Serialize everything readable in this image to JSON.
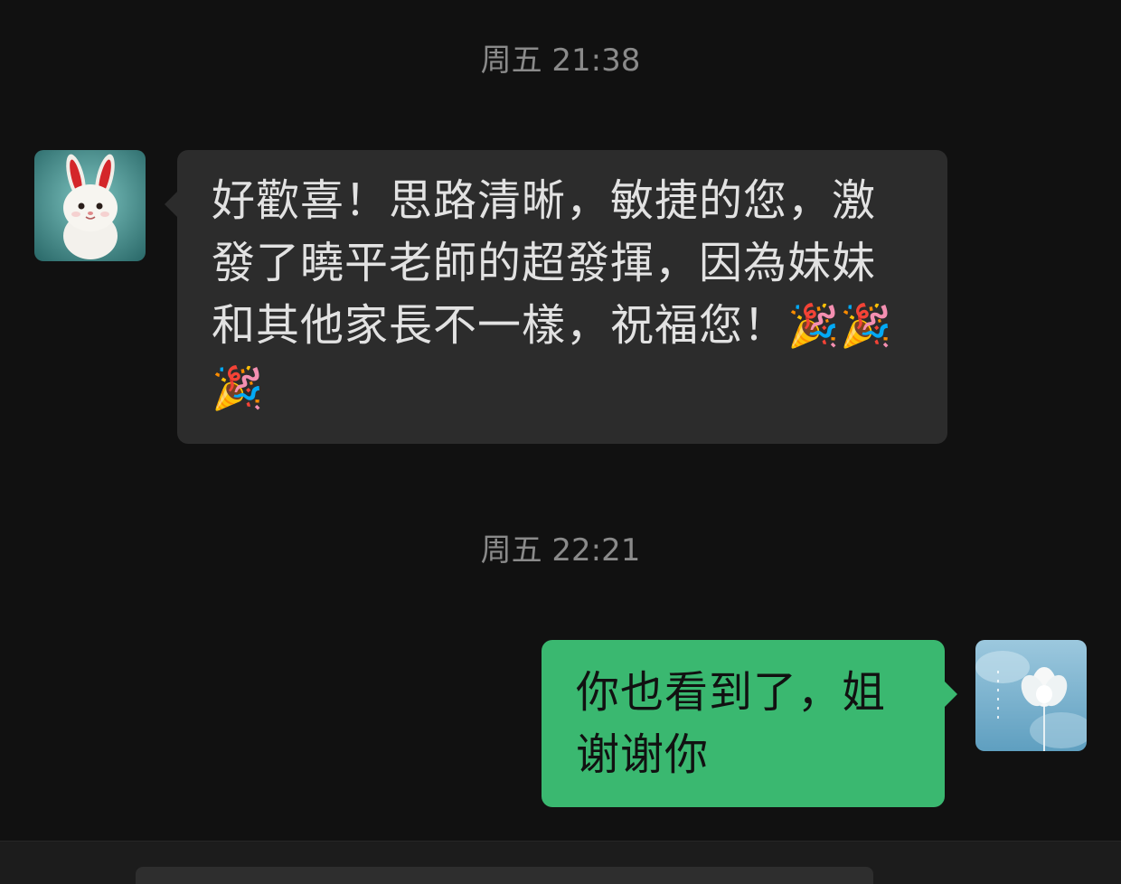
{
  "conversation": {
    "messages": [
      {
        "timestamp": "周五 21:38",
        "direction": "incoming",
        "avatar_icon": "white-rabbit-avatar-icon",
        "text": "好歡喜！思路清晰，敏捷的您，激發了曉平老師的超發揮，因為妹妹和其他家長不一樣，祝福您！",
        "emojis": "🎉🎉🎉"
      },
      {
        "timestamp": "周五 22:21",
        "direction": "outgoing",
        "avatar_icon": "white-lotus-avatar-icon",
        "text": "你也看到了，姐谢谢你"
      }
    ]
  },
  "colors": {
    "background": "#111111",
    "incoming_bubble": "#2c2c2c",
    "outgoing_bubble": "#3ab870",
    "timestamp": "#8a8a8a",
    "input_bar": "#1c1c1c"
  }
}
